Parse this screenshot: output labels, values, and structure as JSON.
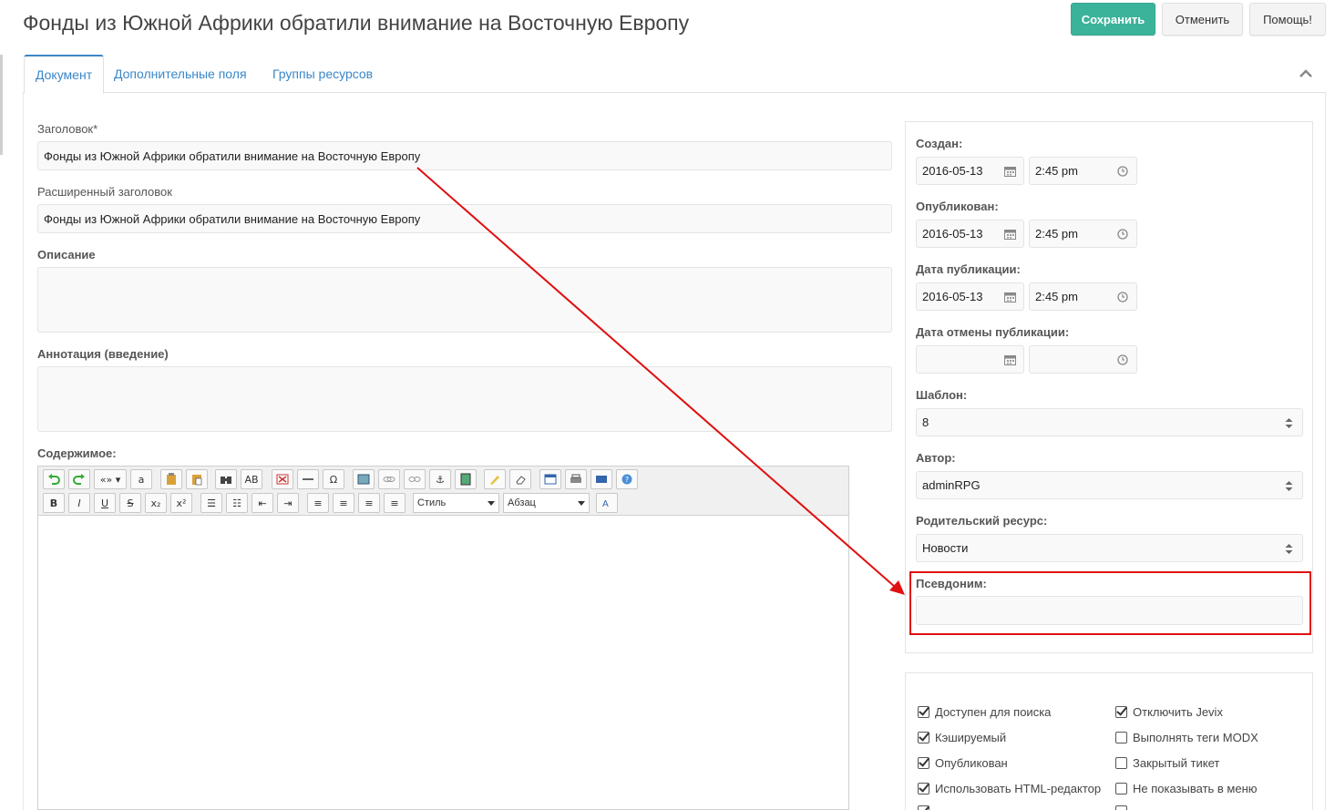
{
  "header": {
    "title": "Фонды из Южной Африки обратили внимание на Восточную Европу",
    "save_label": "Сохранить",
    "cancel_label": "Отменить",
    "help_label": "Помощь!"
  },
  "tabs": [
    {
      "label": "Документ"
    },
    {
      "label": "Дополнительные поля"
    },
    {
      "label": "Группы ресурсов"
    }
  ],
  "form": {
    "title_label": "Заголовок*",
    "title_value": "Фонды из Южной Африки обратили внимание на Восточную Европу",
    "longtitle_label": "Расширенный заголовок",
    "longtitle_value": "Фонды из Южной Африки обратили внимание на Восточную Европу",
    "description_label": "Описание",
    "description_value": "",
    "introtext_label": "Аннотация (введение)",
    "introtext_value": "",
    "content_label": "Содержимое:"
  },
  "editor_toolbar": {
    "style_select": "Стиль",
    "format_select": "Абзац"
  },
  "settings": {
    "created_label": "Создан:",
    "created_date": "2016-05-13",
    "created_time": "2:45 pm",
    "published_label": "Опубликован:",
    "published_date": "2016-05-13",
    "published_time": "2:45 pm",
    "pub_date_label": "Дата публикации:",
    "pub_date_date": "2016-05-13",
    "pub_date_time": "2:45 pm",
    "unpub_date_label": "Дата отмены публикации:",
    "unpub_date_date": "",
    "unpub_date_time": "",
    "template_label": "Шаблон:",
    "template_value": "8",
    "author_label": "Автор:",
    "author_value": "adminRPG",
    "parent_label": "Родительский ресурс:",
    "parent_value": "Новости",
    "alias_label": "Псевдоним:",
    "alias_value": ""
  },
  "checkboxes": {
    "left": [
      {
        "label": "Доступен для поиска",
        "checked": true
      },
      {
        "label": "Кэшируемый",
        "checked": true
      },
      {
        "label": "Опубликован",
        "checked": true
      },
      {
        "label": "Использовать HTML-редактор",
        "checked": true
      }
    ],
    "right": [
      {
        "label": "Отключить Jevix",
        "checked": true
      },
      {
        "label": "Выполнять теги MODX",
        "checked": false
      },
      {
        "label": "Закрытый тикет",
        "checked": false
      },
      {
        "label": "Не показывать в меню",
        "checked": false
      }
    ]
  },
  "colors": {
    "accent": "#3bb39a",
    "link": "#3a86c8",
    "annotation": "#e01010"
  }
}
